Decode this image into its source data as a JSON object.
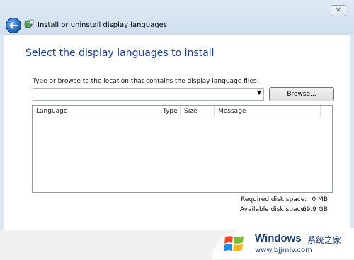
{
  "window": {
    "title": "Install or uninstall display languages",
    "close_glyph": "✕"
  },
  "page": {
    "heading": "Select the display languages to install",
    "path_label": "Type or browse to the location that contains the display language files:",
    "path_value": "",
    "browse_label": "Browse..."
  },
  "list": {
    "columns": [
      "Language",
      "Type",
      "Size",
      "Message"
    ]
  },
  "disk": {
    "required_label": "Required disk space:",
    "required_value": "0 MB",
    "available_label": "Available disk space:",
    "available_value": "69.9 GB"
  },
  "watermark": {
    "brand": "Windows",
    "chinese": "系统之家",
    "url": "www.bjjmlv.com"
  },
  "icons": {
    "back": "back-arrow-icon",
    "title": "language-pack-icon",
    "dropdown": "chevron-down-icon",
    "watermark": "windows-logo-icon"
  },
  "colors": {
    "heading": "#1e3f91",
    "back_button": "#1a5fb4"
  }
}
